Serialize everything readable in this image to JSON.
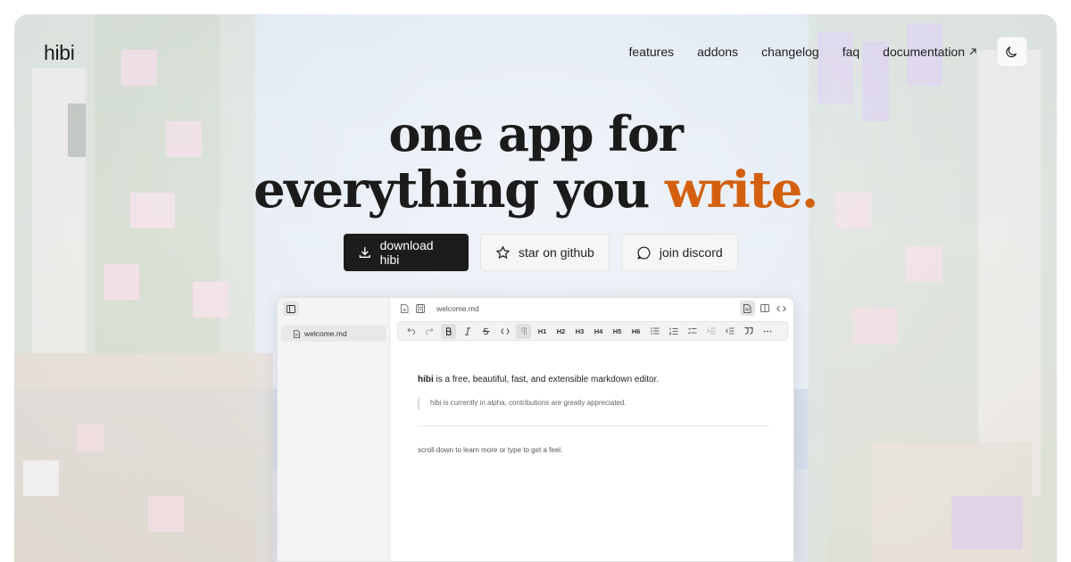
{
  "nav": {
    "logo": "hibi",
    "links": [
      {
        "label": "features"
      },
      {
        "label": "addons"
      },
      {
        "label": "changelog"
      },
      {
        "label": "faq"
      },
      {
        "label": "documentation",
        "icon": "external-arrow-icon"
      }
    ],
    "theme_toggle_icon": "moon-icon"
  },
  "hero": {
    "line1": "one app for",
    "line2_plain": "everything you ",
    "line2_accent": "write.",
    "accent_color": "#d4600f"
  },
  "cta": {
    "download": {
      "label": "download hibi",
      "icon": "download-icon"
    },
    "github": {
      "label": "star on github",
      "icon": "star-icon"
    },
    "discord": {
      "label": "join discord",
      "icon": "chat-bubble-icon"
    }
  },
  "app": {
    "sidebar": {
      "files": [
        {
          "name": "welcome.md",
          "icon": "file-icon"
        }
      ]
    },
    "topbar": {
      "filename": "welcome.md"
    },
    "toolbar": {
      "tools": [
        "undo-icon",
        "redo-icon",
        "bold-icon",
        "italic-icon",
        "strikethrough-icon",
        "code-icon",
        "paragraph-icon",
        "H1",
        "H2",
        "H3",
        "H4",
        "H5",
        "H6",
        "bullet-list-icon",
        "ordered-list-icon",
        "checklist-icon",
        "indent-icon",
        "outdent-icon",
        "quote-icon",
        "more-icon"
      ]
    },
    "editor": {
      "p1_bold": "hibi",
      "p1_rest": " is a free, beautiful, fast, and extensible markdown editor.",
      "quote": "hibi is currently in alpha, contributions are greatly appreciated.",
      "p2": "scroll down to learn more or type to get a feel."
    }
  }
}
